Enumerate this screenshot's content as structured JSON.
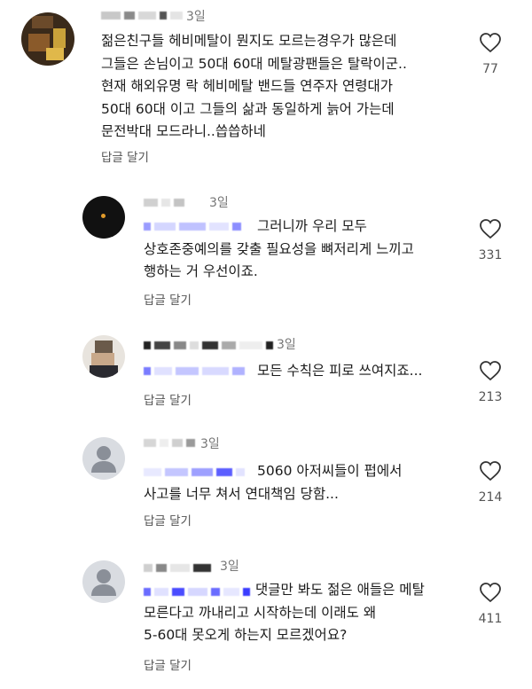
{
  "comments": [
    {
      "time": "3일",
      "text": "젊은친구들 헤비메탈이 뭔지도 모르는경우가 많은데\n그들은 손님이고 50대 60대 메탈광팬들은 탈락이군..\n현재 해외유명 락 헤비메탈 밴드들 연주자 연령대가\n50대 60대 이고 그들의 삶과 동일하게 늙어 가는데\n문전박대 모드라니..씁씁하네",
      "reply_label": "답글 달기",
      "likes": "77"
    },
    {
      "time": "3일",
      "text": "그러니까 우리 모두\n상호존중예의를 갖출 필요성을 뼈저리게 느끼고\n행하는 거 우선이죠.",
      "reply_label": "답글 달기",
      "likes": "331"
    },
    {
      "time": "3일",
      "text": "모든 수칙은 피로 쓰여지죠...",
      "reply_label": "답글 달기",
      "likes": "213"
    },
    {
      "time": "3일",
      "text": "5060 아저씨들이 펍에서\n사고를 너무 쳐서 연대책임 당함...",
      "reply_label": "답글 달기",
      "likes": "214"
    },
    {
      "time": "3일",
      "text": "댓글만 봐도 젊은 애들은 메탈\n모른다고 까내리고 시작하는데 이래도 왜\n5-60대 못오게 하는지 모르겠어요?",
      "reply_label": "답글 달기",
      "likes": "411"
    }
  ],
  "icons": {
    "like": "heart-outline-icon",
    "default_avatar": "person-placeholder-icon"
  },
  "colors": {
    "mention": "#6b6cff",
    "meta": "#777777",
    "text": "#1a1a1a"
  }
}
